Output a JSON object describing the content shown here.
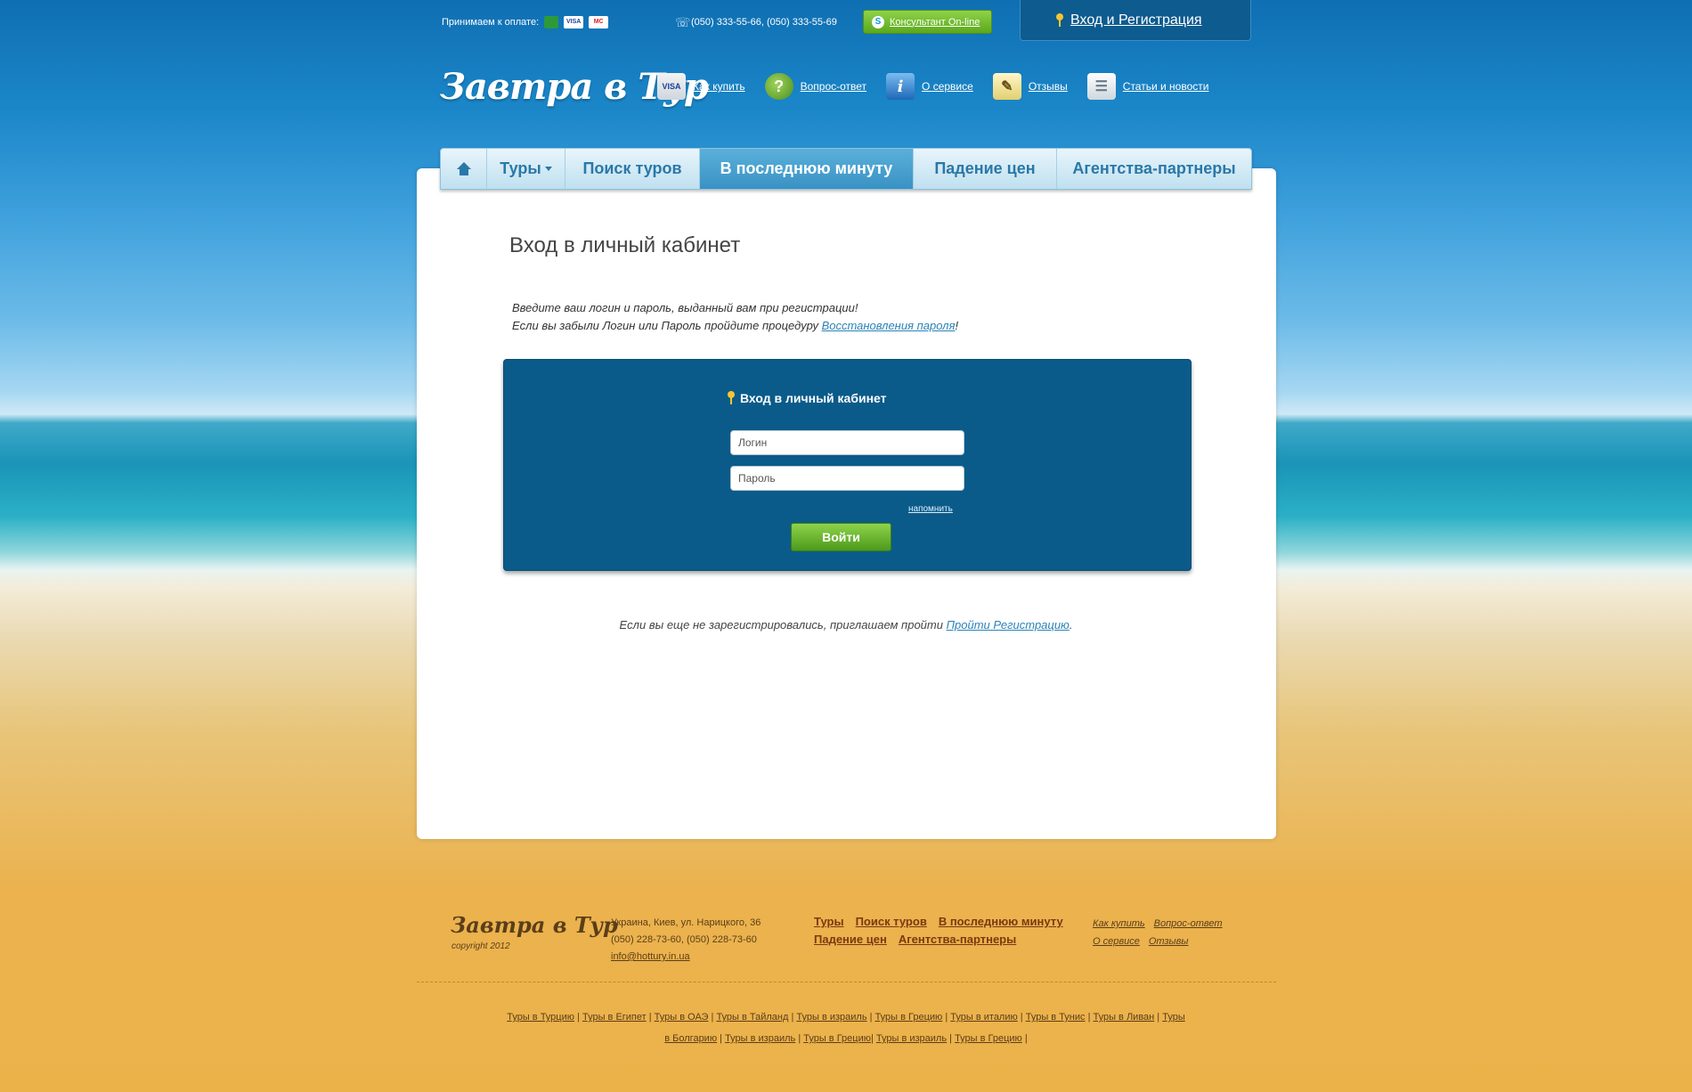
{
  "topbar": {
    "payment_label": "Принимаем к оплате:",
    "payment_cards": [
      "",
      "VISA",
      "MC"
    ],
    "phones": "(050) 333-55-66,  (050) 333-55-69",
    "consultant": "Консультант On-line",
    "login_register": "Вход и Регистрация"
  },
  "header": {
    "logo": "Завтра в Тур",
    "links": [
      {
        "label": "Как купить",
        "icon": "credit-card-icon"
      },
      {
        "label": "Вопрос-ответ",
        "icon": "question-bubble-icon"
      },
      {
        "label": "О сервисе",
        "icon": "info-icon"
      },
      {
        "label": "Отзывы",
        "icon": "pencil-note-icon"
      },
      {
        "label": "Статьи и новости",
        "icon": "newspaper-icon"
      }
    ]
  },
  "menu": {
    "items": [
      "Туры",
      "Поиск туров",
      "В последнюю минуту",
      "Падение цен",
      "Агентства-партнеры"
    ],
    "active": "В последнюю минуту"
  },
  "main": {
    "title": "Вход в личный кабинет",
    "intro_line1": "Введите ваш логин и пароль, выданный вам при регистрации!",
    "intro_line2_before": "Если вы забыли Логин или Пароль пройдите процедуру ",
    "intro_link": "Восстановления пароля",
    "intro_line2_after": "!",
    "login_box": {
      "title": "Вход в личный кабинет",
      "login_placeholder": "Логин",
      "password_placeholder": "Пароль",
      "remind": "напомнить",
      "submit": "Войти"
    },
    "register_note": "Если вы еще не зарегистрировались, приглашаем пройти ",
    "register_link": "Пройти Регистрацию",
    "register_after": "."
  },
  "footer": {
    "logo": "Завтра в Тур",
    "copyright": "copyright 2012",
    "address": "Украина, Киев, ул. Нарицкого, 36",
    "phones": "(050) 228-73-60, (050) 228-73-60",
    "email": "info@hottury.in.ua",
    "menu": [
      "Туры",
      "Поиск туров",
      "В последнюю минуту",
      "Падение цен",
      "Агентства-партнеры"
    ],
    "small_links": [
      "Как купить",
      "Вопрос-ответ",
      "О сервисе",
      "Отзывы"
    ],
    "tags_line1": [
      "Туры в Турцию",
      "Туры в Египет",
      "Туры в ОАЭ",
      "Туры в Тайланд",
      "Туры в израиль",
      "Туры в Грецию",
      "Туры в италию",
      "Туры в Тунис",
      "Туры в Ливан",
      "Туры"
    ],
    "tags_line2": [
      "в Болгарию",
      "Туры в израиль",
      "Туры в Грецию",
      "Туры в израиль",
      "Туры в Грецию"
    ]
  }
}
